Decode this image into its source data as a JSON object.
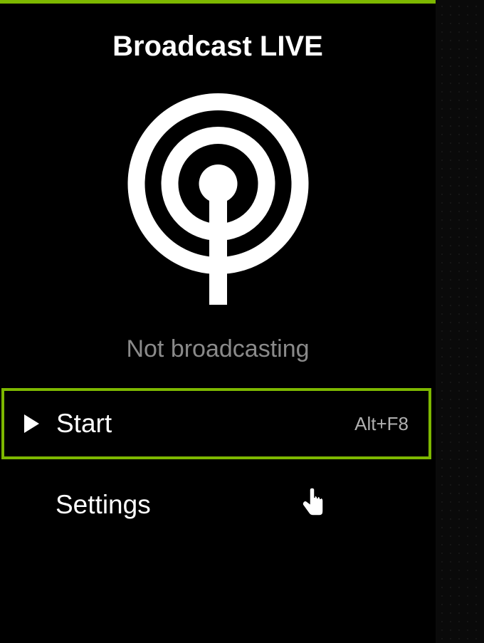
{
  "header": {
    "title": "Broadcast LIVE"
  },
  "status": {
    "text": "Not broadcasting"
  },
  "menu": {
    "start": {
      "label": "Start",
      "shortcut": "Alt+F8"
    },
    "settings": {
      "label": "Settings"
    }
  },
  "colors": {
    "accent": "#7db700",
    "background": "#000000",
    "text": "#ffffff",
    "muted": "#8a8a8a"
  }
}
